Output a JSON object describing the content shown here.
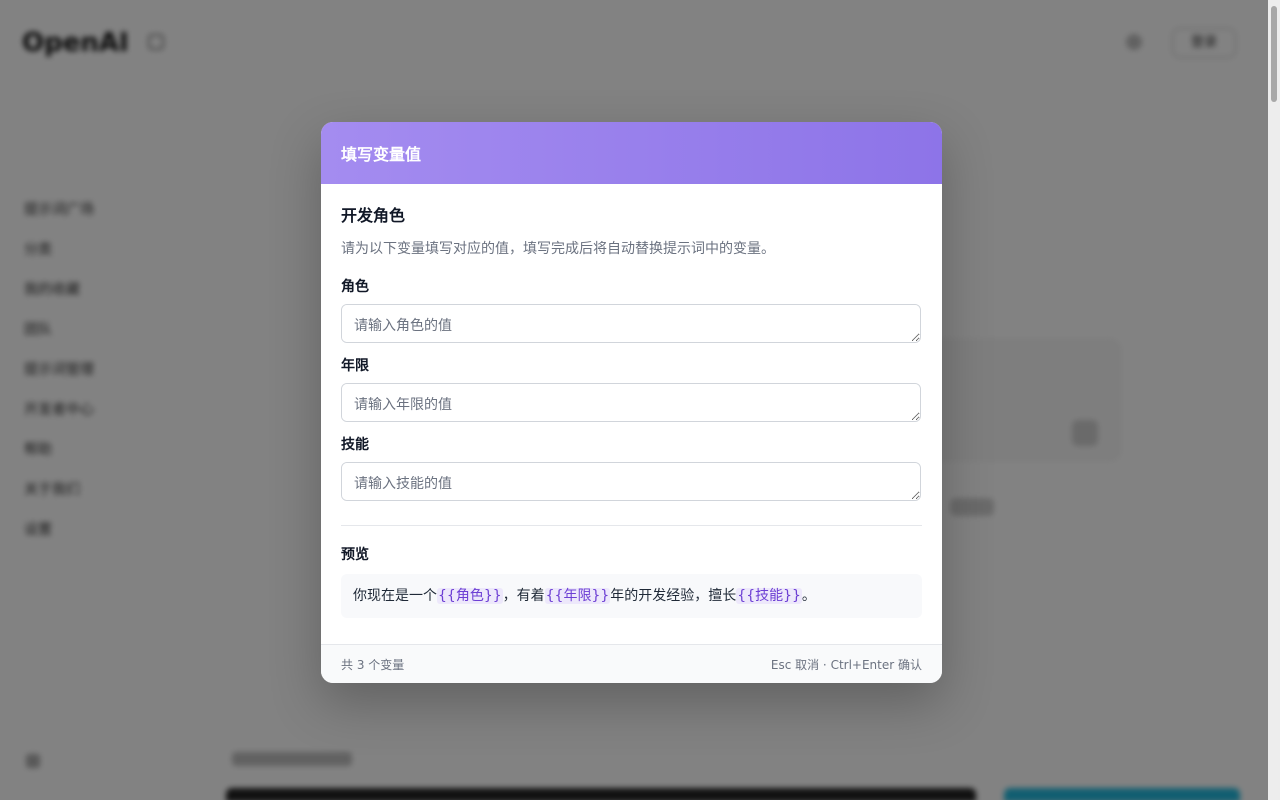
{
  "background": {
    "logo": "OpenAI",
    "login_label": "登录",
    "nav_items": [
      "提示词广场",
      "分类",
      "我的收藏",
      "团队",
      "提示词管理",
      "开发者中心",
      "帮助",
      "关于我们",
      "设置"
    ]
  },
  "modal": {
    "title": "填写变量值",
    "prompt_title": "开发角色",
    "description": "请为以下变量填写对应的值，填写完成后将自动替换提示词中的变量。",
    "fields": [
      {
        "label": "角色",
        "value": "",
        "placeholder": "请输入角色的值"
      },
      {
        "label": "年限",
        "value": "",
        "placeholder": "请输入年限的值"
      },
      {
        "label": "技能",
        "value": "",
        "placeholder": "请输入技能的值"
      }
    ],
    "preview": {
      "label": "预览",
      "segments": [
        {
          "text": "你现在是一个",
          "variable": false
        },
        {
          "text": "{{角色}}",
          "variable": true
        },
        {
          "text": "，有着",
          "variable": false
        },
        {
          "text": "{{年限}}",
          "variable": true
        },
        {
          "text": "年的开发经验，擅长",
          "variable": false
        },
        {
          "text": "{{技能}}",
          "variable": true
        },
        {
          "text": "。",
          "variable": false
        }
      ]
    },
    "footer": {
      "count_text": "共 3 个变量",
      "shortcut_text": "Esc 取消 · Ctrl+Enter 确认"
    }
  },
  "colors": {
    "header_gradient_start": "#a48cf0",
    "header_gradient_end": "#8d74e8",
    "variable_text": "#6d3fd4",
    "variable_bg": "#ede8fb"
  }
}
